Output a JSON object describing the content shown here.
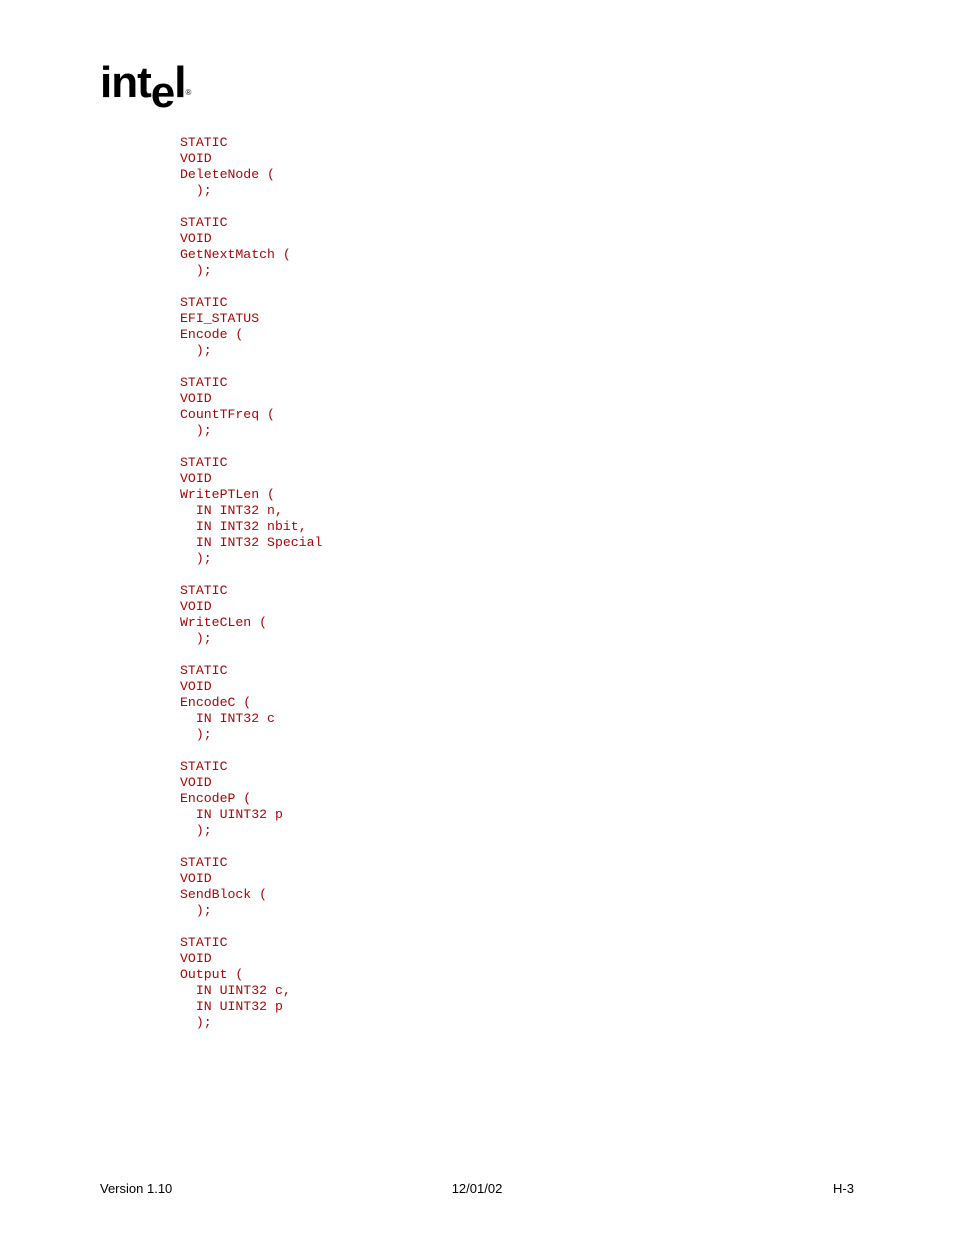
{
  "logo": {
    "part1": "int",
    "part2": "e",
    "part3": "l",
    "reg": "®"
  },
  "code": "STATIC\nVOID\nDeleteNode (\n  );\n\nSTATIC\nVOID\nGetNextMatch (\n  );\n\nSTATIC\nEFI_STATUS\nEncode (\n  );\n\nSTATIC\nVOID\nCountTFreq (\n  );\n\nSTATIC\nVOID\nWritePTLen (\n  IN INT32 n,\n  IN INT32 nbit,\n  IN INT32 Special\n  );\n\nSTATIC\nVOID\nWriteCLen (\n  );\n\nSTATIC\nVOID\nEncodeC (\n  IN INT32 c\n  );\n\nSTATIC\nVOID\nEncodeP (\n  IN UINT32 p\n  );\n\nSTATIC\nVOID\nSendBlock (\n  );\n\nSTATIC\nVOID\nOutput (\n  IN UINT32 c,\n  IN UINT32 p\n  );",
  "footer": {
    "version": "Version 1.10",
    "date": "12/01/02",
    "page": "H-3"
  }
}
